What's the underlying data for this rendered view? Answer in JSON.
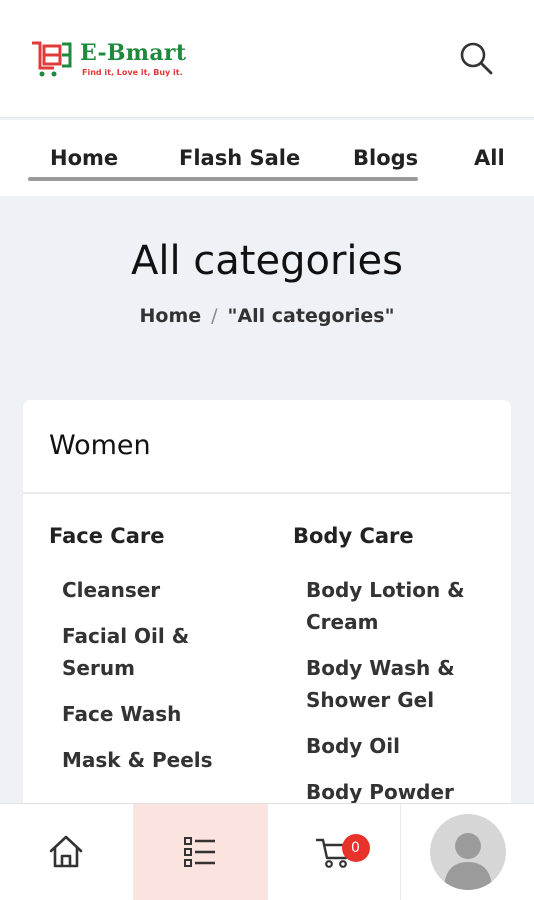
{
  "header": {
    "logo_text": "E-Bmart",
    "logo_tagline": "Find it, Love it, Buy it.",
    "search_icon": "search-icon"
  },
  "nav": {
    "items": [
      "Home",
      "Flash Sale",
      "Blogs",
      "All"
    ]
  },
  "page": {
    "title": "All categories",
    "breadcrumb": {
      "home": "Home",
      "separator": "/",
      "current": "\"All categories\""
    }
  },
  "category": {
    "name": "Women",
    "columns": [
      {
        "title": "Face Care",
        "items": [
          "Cleanser",
          "Facial Oil & Serum",
          "Face Wash",
          "Mask & Peels"
        ]
      },
      {
        "title": "Body Care",
        "items": [
          "Body Lotion & Cream",
          "Body Wash & Shower Gel",
          "Body Oil",
          "Body Powder"
        ]
      }
    ]
  },
  "bottom_bar": {
    "tabs": [
      "home-icon",
      "categories-icon",
      "cart-icon",
      "avatar"
    ],
    "cart_count": "0"
  },
  "colors": {
    "brand_green": "#1e8a3e",
    "brand_red": "#e03b3b",
    "active_tab_bg": "#fbe3df",
    "badge_red": "#e8322b",
    "page_bg": "#eef1f6"
  }
}
